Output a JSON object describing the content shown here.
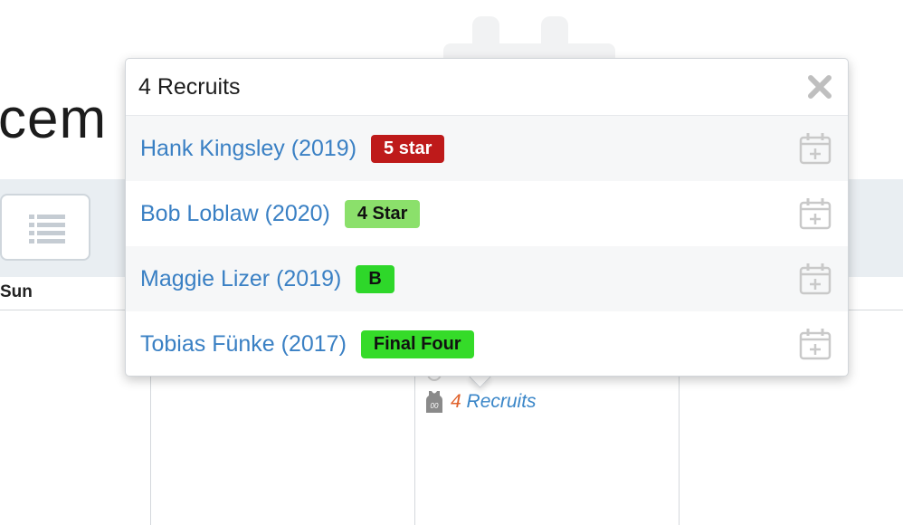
{
  "page": {
    "month_title_partial": "cem",
    "day_header_sun": "Sun"
  },
  "calendar_cell": {
    "recruits_count": "4",
    "recruits_label": "Recruits"
  },
  "popover": {
    "title": "4 Recruits",
    "close_icon": "close-icon",
    "recruits": [
      {
        "name": "Hank Kingsley (2019)",
        "badge": "5 star",
        "badge_color": "#be1a1a"
      },
      {
        "name": "Bob Loblaw (2020)",
        "badge": "4 Star",
        "badge_color": "#8be06b"
      },
      {
        "name": "Maggie Lizer (2019)",
        "badge": "B",
        "badge_color": "#2ed72a"
      },
      {
        "name": "Tobias Fünke (2017)",
        "badge": "Final Four",
        "badge_color": "#35db29"
      }
    ],
    "row_action_icon": "calendar-add-icon"
  },
  "colors": {
    "link_blue": "#3a80c4",
    "count_orange": "#e0612a",
    "toolbar_band": "#e9eef2"
  }
}
